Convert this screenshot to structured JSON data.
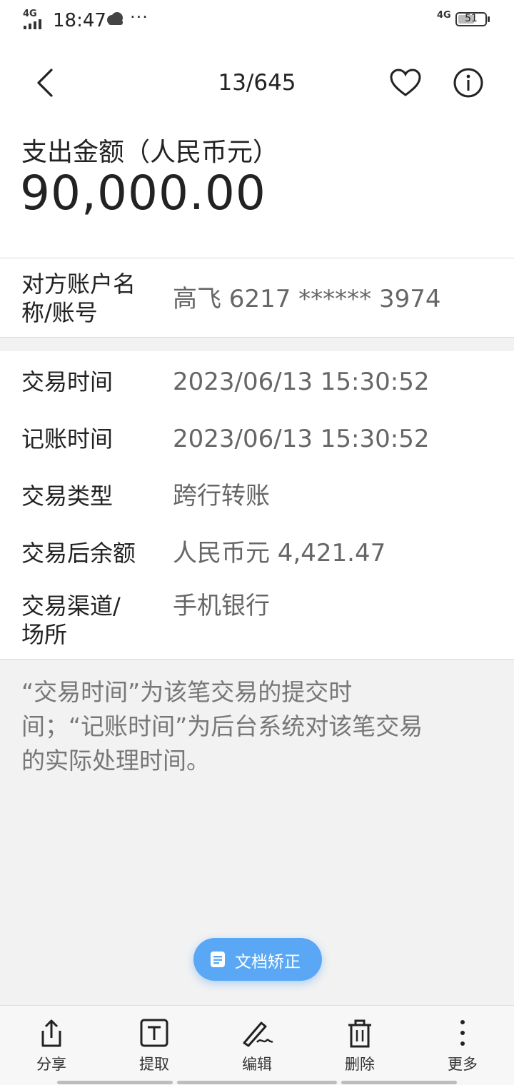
{
  "status_bar": {
    "network_left": "4G",
    "time": "18:47",
    "more": "···",
    "network_right": "4G",
    "battery": "51"
  },
  "header": {
    "counter": "13/645"
  },
  "amount": {
    "label": "支出金额（人民币元）",
    "value": "90,000.00"
  },
  "counterparty": {
    "label_line1": "对方账户名",
    "label_line2": "称/账号",
    "value": "高飞 6217 ****** 3974"
  },
  "details": [
    {
      "label": "交易时间",
      "value": "2023/06/13  15:30:52"
    },
    {
      "label": "记账时间",
      "value": "2023/06/13  15:30:52"
    },
    {
      "label": "交易类型",
      "value": "跨行转账"
    },
    {
      "label": "交易后余额",
      "value": "人民币元 4,421.47"
    },
    {
      "label_line1": "交易渠道/",
      "label_line2": "场所",
      "value": "手机银行"
    }
  ],
  "note": {
    "line1": "“交易时间”为该笔交易的提交时",
    "line2": "间；“记账时间”为后台系统对该笔交易",
    "line3": "的实际处理时间。"
  },
  "fab": {
    "label": "文档矫正",
    "icon": "document-icon"
  },
  "toolbar": {
    "share": "分享",
    "extract": "提取",
    "edit": "编辑",
    "delete": "删除",
    "more": "更多"
  },
  "colors": {
    "accent": "#5aa8f5",
    "background": "#f2f2f2",
    "value_text": "#666666"
  }
}
